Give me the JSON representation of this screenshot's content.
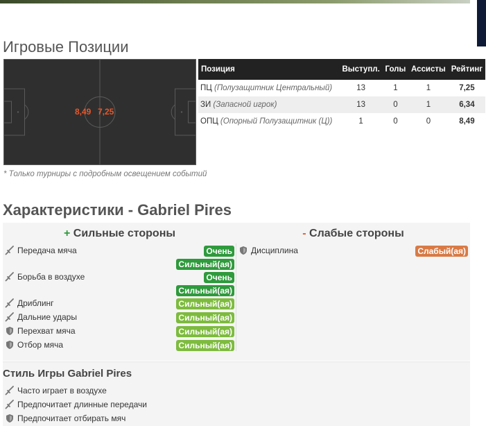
{
  "positions_section": {
    "title": "Игровые Позиции",
    "pitch_ratings": [
      "8,49",
      "7,25"
    ],
    "table": {
      "headers": [
        "Позиция",
        "Выступл.",
        "Голы",
        "Ассисты",
        "Рейтинг"
      ],
      "rows": [
        {
          "code": "ПЦ",
          "full": "(Полузащитник Центральный)",
          "apps": "13",
          "goals": "1",
          "assists": "1",
          "rating": "7,25"
        },
        {
          "code": "ЗИ",
          "full": "(Запасной игрок)",
          "apps": "13",
          "goals": "0",
          "assists": "1",
          "rating": "6,34"
        },
        {
          "code": "ОПЦ",
          "full": "(Опорный Полузащитник (Ц))",
          "apps": "1",
          "goals": "0",
          "assists": "0",
          "rating": "8,49"
        }
      ]
    },
    "footnote": "* Только турниры с подробным освещением событий"
  },
  "characteristics": {
    "title": "Характеристики - Gabriel Pires",
    "strengths_sign": "+",
    "strengths_title": "Сильные стороны",
    "weaknesses_sign": "-",
    "weaknesses_title": "Слабые стороны",
    "strengths": [
      {
        "label": "Передача мяча",
        "icon": "sword-icon",
        "badges": [
          "Очень",
          "Сильный(ая)"
        ],
        "level": "very-strong"
      },
      {
        "label": "Борьба в воздухе",
        "icon": "sword-icon",
        "badges": [
          "Очень",
          "Сильный(ая)"
        ],
        "level": "very-strong"
      },
      {
        "label": "Дриблинг",
        "icon": "sword-icon",
        "badges": [
          "Сильный(ая)"
        ],
        "level": "strong"
      },
      {
        "label": "Дальние удары",
        "icon": "sword-icon",
        "badges": [
          "Сильный(ая)"
        ],
        "level": "strong"
      },
      {
        "label": "Перехват мяча",
        "icon": "shield-icon",
        "badges": [
          "Сильный(ая)"
        ],
        "level": "strong"
      },
      {
        "label": "Отбор мяча",
        "icon": "shield-icon",
        "badges": [
          "Сильный(ая)"
        ],
        "level": "strong"
      }
    ],
    "weaknesses": [
      {
        "label": "Дисциплина",
        "icon": "shield-icon",
        "badges": [
          "Слабый(ая)"
        ],
        "level": "weak"
      }
    ]
  },
  "play_style": {
    "title": "Стиль Игры Gabriel Pires",
    "items": [
      {
        "label": "Часто играет в воздухе",
        "icon": "sword-icon"
      },
      {
        "label": "Предпочитает длинные передачи",
        "icon": "sword-icon"
      },
      {
        "label": "Предпочитает отбирать мяч",
        "icon": "shield-icon"
      }
    ]
  },
  "colors": {
    "rating": "#e8562a",
    "very_strong": "#2e9a3c",
    "strong": "#7dbb3e",
    "weak": "#d97a45",
    "header_bg": "#222222"
  }
}
